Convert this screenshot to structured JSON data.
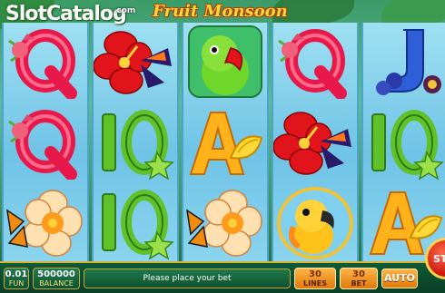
{
  "header": {
    "logo_text": "SlotCatalog",
    "logo_suffix": ".com",
    "game_title": "Fruit Monsoon"
  },
  "reels": [
    [
      "letter-q",
      "letter-q",
      "flower-orange"
    ],
    [
      "flower-red",
      "number-10",
      "number-10"
    ],
    [
      "parrot-green",
      "letter-a",
      "flower-orange"
    ],
    [
      "letter-q",
      "flower-red",
      "parrot-yellow"
    ],
    [
      "letter-j",
      "number-10",
      "letter-a"
    ]
  ],
  "bottom_bar": {
    "coin_value": "0.01",
    "coin_label": "FUN",
    "balance_value": "500000",
    "balance_label": "BALANCE",
    "message": "Please place your bet",
    "lines_value": "30",
    "lines_label": "LINES",
    "bet_value": "30",
    "bet_label": "BET",
    "auto_label": "AUTO",
    "spin_label": "ST"
  },
  "colors": {
    "accent_gold": "#d8b33b",
    "bar_green": "#0e5232",
    "spin_red": "#c7140c"
  }
}
